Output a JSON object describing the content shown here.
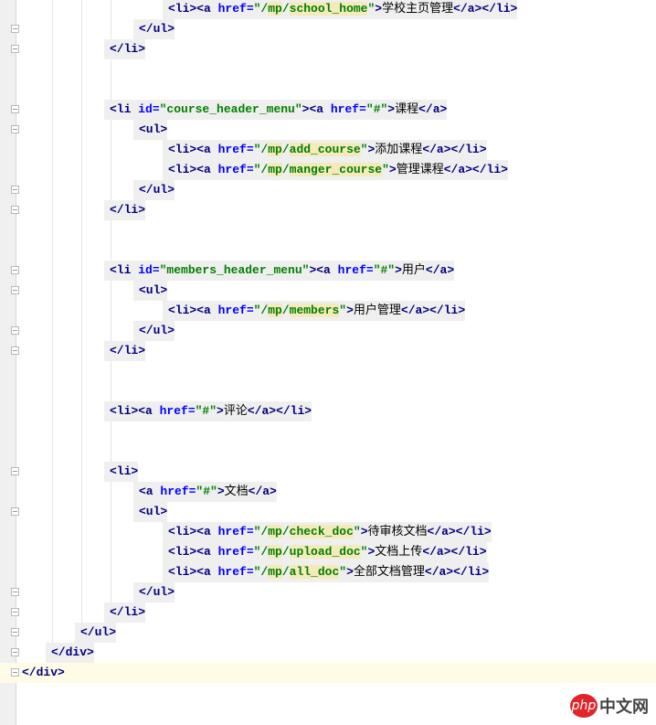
{
  "lines": [
    {
      "indent": 5,
      "tokens": [
        [
          "t",
          "<li><a "
        ],
        [
          "a",
          "href="
        ],
        [
          "v",
          "\"/"
        ],
        [
          "m",
          "mp"
        ],
        [
          "v",
          "/"
        ],
        [
          "m",
          "school_home"
        ],
        [
          "v",
          "\""
        ],
        [
          "t",
          ">"
        ],
        [
          "x",
          "学校主页管理"
        ],
        [
          "t",
          "</a></li>"
        ]
      ]
    },
    {
      "indent": 4,
      "fold": true,
      "tokens": [
        [
          "t",
          "</ul>"
        ]
      ]
    },
    {
      "indent": 3,
      "fold": true,
      "tokens": [
        [
          "t",
          "</li>"
        ]
      ]
    },
    {
      "indent": 0,
      "tokens": []
    },
    {
      "indent": 0,
      "tokens": []
    },
    {
      "indent": 3,
      "fold": true,
      "tokens": [
        [
          "t",
          "<li "
        ],
        [
          "a",
          "id="
        ],
        [
          "v",
          "\"course_header_menu\""
        ],
        [
          "t",
          "><a "
        ],
        [
          "a",
          "href="
        ],
        [
          "v",
          "\"#\""
        ],
        [
          "t",
          ">"
        ],
        [
          "x",
          "课程"
        ],
        [
          "t",
          "</a>"
        ]
      ]
    },
    {
      "indent": 4,
      "fold": true,
      "tokens": [
        [
          "t",
          "<ul>"
        ]
      ]
    },
    {
      "indent": 5,
      "tokens": [
        [
          "t",
          "<li><a "
        ],
        [
          "a",
          "href="
        ],
        [
          "v",
          "\"/"
        ],
        [
          "m",
          "mp"
        ],
        [
          "v",
          "/"
        ],
        [
          "m",
          "add_course"
        ],
        [
          "v",
          "\""
        ],
        [
          "t",
          ">"
        ],
        [
          "x",
          "添加课程"
        ],
        [
          "t",
          "</a></li>"
        ]
      ]
    },
    {
      "indent": 5,
      "tokens": [
        [
          "t",
          "<li><a "
        ],
        [
          "a",
          "href="
        ],
        [
          "v",
          "\"/"
        ],
        [
          "m",
          "mp"
        ],
        [
          "v",
          "/"
        ],
        [
          "m",
          "manger_course"
        ],
        [
          "v",
          "\""
        ],
        [
          "t",
          ">"
        ],
        [
          "x",
          "管理课程"
        ],
        [
          "t",
          "</a></li>"
        ]
      ]
    },
    {
      "indent": 4,
      "fold": true,
      "tokens": [
        [
          "t",
          "</ul>"
        ]
      ]
    },
    {
      "indent": 3,
      "fold": true,
      "tokens": [
        [
          "t",
          "</li>"
        ]
      ]
    },
    {
      "indent": 0,
      "tokens": []
    },
    {
      "indent": 0,
      "tokens": []
    },
    {
      "indent": 3,
      "fold": true,
      "tokens": [
        [
          "t",
          "<li "
        ],
        [
          "a",
          "id="
        ],
        [
          "v",
          "\"members_header_menu\""
        ],
        [
          "t",
          "><a "
        ],
        [
          "a",
          "href="
        ],
        [
          "v",
          "\"#\""
        ],
        [
          "t",
          ">"
        ],
        [
          "x",
          "用户"
        ],
        [
          "t",
          "</a>"
        ]
      ]
    },
    {
      "indent": 4,
      "fold": true,
      "tokens": [
        [
          "t",
          "<ul>"
        ]
      ]
    },
    {
      "indent": 5,
      "tokens": [
        [
          "t",
          "<li><a "
        ],
        [
          "a",
          "href="
        ],
        [
          "v",
          "\"/"
        ],
        [
          "m",
          "mp"
        ],
        [
          "v",
          "/"
        ],
        [
          "m",
          "members"
        ],
        [
          "v",
          "\""
        ],
        [
          "t",
          ">"
        ],
        [
          "x",
          "用户管理"
        ],
        [
          "t",
          "</a></li>"
        ]
      ]
    },
    {
      "indent": 4,
      "fold": true,
      "tokens": [
        [
          "t",
          "</ul>"
        ]
      ]
    },
    {
      "indent": 3,
      "fold": true,
      "tokens": [
        [
          "t",
          "</li>"
        ]
      ]
    },
    {
      "indent": 0,
      "tokens": []
    },
    {
      "indent": 0,
      "tokens": []
    },
    {
      "indent": 3,
      "tokens": [
        [
          "t",
          "<li><a "
        ],
        [
          "a",
          "href="
        ],
        [
          "v",
          "\"#\""
        ],
        [
          "t",
          ">"
        ],
        [
          "x",
          "评论"
        ],
        [
          "t",
          "</a></li>"
        ]
      ]
    },
    {
      "indent": 0,
      "tokens": []
    },
    {
      "indent": 0,
      "tokens": []
    },
    {
      "indent": 3,
      "fold": true,
      "tokens": [
        [
          "t",
          "<li>"
        ]
      ]
    },
    {
      "indent": 4,
      "tokens": [
        [
          "t",
          "<a "
        ],
        [
          "a",
          "href="
        ],
        [
          "v",
          "\"#\""
        ],
        [
          "t",
          ">"
        ],
        [
          "x",
          "文档"
        ],
        [
          "t",
          "</a>"
        ]
      ]
    },
    {
      "indent": 4,
      "fold": true,
      "tokens": [
        [
          "t",
          "<ul>"
        ]
      ]
    },
    {
      "indent": 5,
      "tokens": [
        [
          "t",
          "<li><a "
        ],
        [
          "a",
          "href="
        ],
        [
          "v",
          "\"/"
        ],
        [
          "m",
          "mp"
        ],
        [
          "v",
          "/"
        ],
        [
          "m",
          "check_doc"
        ],
        [
          "v",
          "\""
        ],
        [
          "t",
          ">"
        ],
        [
          "x",
          "待审核文档"
        ],
        [
          "t",
          "</a></li>"
        ]
      ]
    },
    {
      "indent": 5,
      "tokens": [
        [
          "t",
          "<li><a "
        ],
        [
          "a",
          "href="
        ],
        [
          "v",
          "\"/"
        ],
        [
          "m",
          "mp"
        ],
        [
          "v",
          "/"
        ],
        [
          "m",
          "upload_doc"
        ],
        [
          "v",
          "\""
        ],
        [
          "t",
          ">"
        ],
        [
          "x",
          "文档上传"
        ],
        [
          "t",
          "</a></li>"
        ]
      ]
    },
    {
      "indent": 5,
      "tokens": [
        [
          "t",
          "<li><a "
        ],
        [
          "a",
          "href="
        ],
        [
          "v",
          "\"/"
        ],
        [
          "m",
          "mp"
        ],
        [
          "v",
          "/"
        ],
        [
          "m",
          "all_doc"
        ],
        [
          "v",
          "\""
        ],
        [
          "t",
          ">"
        ],
        [
          "x",
          "全部文档管理"
        ],
        [
          "t",
          "</a></li>"
        ]
      ]
    },
    {
      "indent": 4,
      "fold": true,
      "tokens": [
        [
          "t",
          "</ul>"
        ]
      ]
    },
    {
      "indent": 3,
      "fold": true,
      "tokens": [
        [
          "t",
          "</li>"
        ]
      ]
    },
    {
      "indent": 2,
      "fold": true,
      "tokens": [
        [
          "t",
          "</ul>"
        ]
      ]
    },
    {
      "indent": 1,
      "fold": true,
      "tokens": [
        [
          "t",
          "</div>"
        ]
      ]
    },
    {
      "indent": 0,
      "fold": true,
      "current": true,
      "tokens": [
        [
          "t",
          "</div>"
        ]
      ]
    }
  ],
  "watermark": {
    "logo": "php",
    "text": "中文网"
  }
}
